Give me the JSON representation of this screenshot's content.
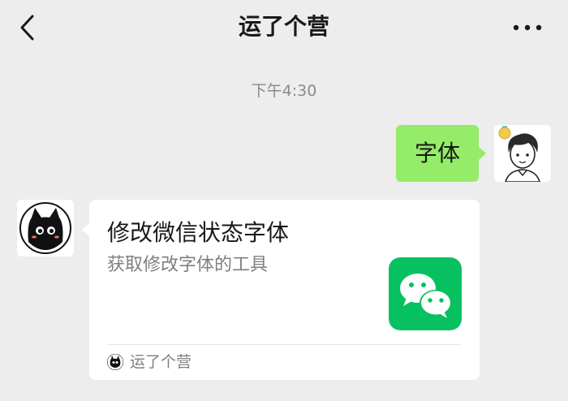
{
  "header": {
    "title": "运了个营",
    "back_icon": "chevron-left-icon",
    "more_icon": "more-dots-icon"
  },
  "timestamp": "下午4:30",
  "messages": {
    "outgoing": {
      "text": "字体",
      "bubble_color": "#95ec69",
      "avatar": "cartoon-boy-avatar"
    },
    "incoming_card": {
      "title": "修改微信状态字体",
      "description": "获取修改字体的工具",
      "thumbnail": "wechat-logo-icon",
      "source_name": "运了个营",
      "source_icon": "black-cat-icon",
      "avatar": "black-cat-avatar"
    }
  },
  "colors": {
    "background": "#ededed",
    "wechat_green": "#07c160"
  }
}
